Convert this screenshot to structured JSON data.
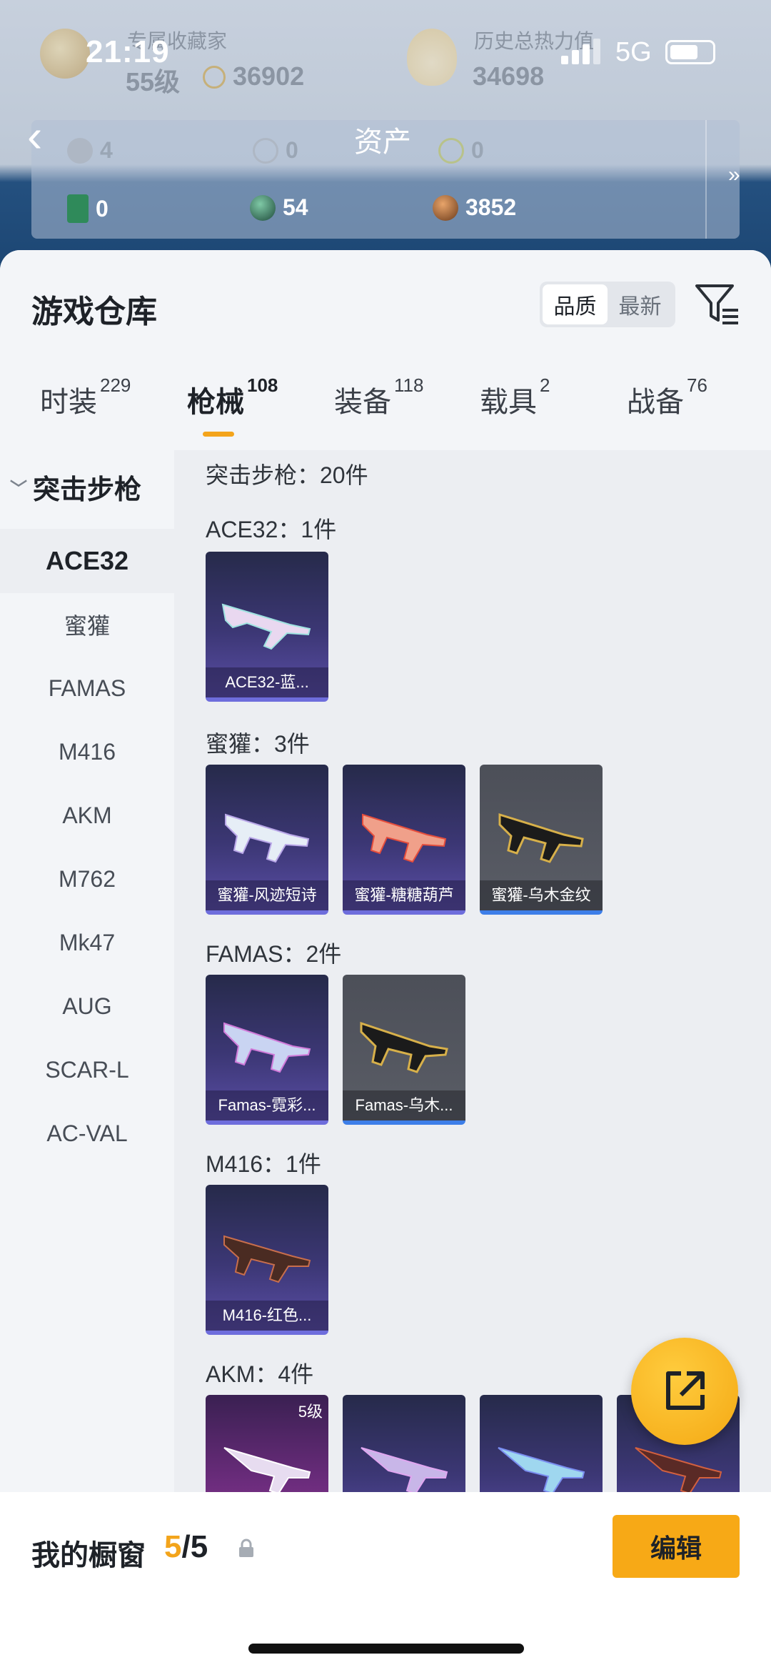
{
  "status": {
    "time": "21:19",
    "network": "5G"
  },
  "header": {
    "collector_label": "专属收藏家",
    "level": "55级",
    "coins": "36902",
    "heat_label": "历史总热力值",
    "heat_value": "34698",
    "title": "资产",
    "assets_row1": [
      "4",
      "0",
      "0"
    ],
    "assets_row2": [
      "0",
      "54",
      "3852"
    ]
  },
  "warehouse": {
    "title": "游戏仓库",
    "sort_options": [
      "品质",
      "最新"
    ],
    "sort_active": "品质"
  },
  "tabs": [
    {
      "label": "时装",
      "count": "229"
    },
    {
      "label": "枪械",
      "count": "108"
    },
    {
      "label": "装备",
      "count": "118"
    },
    {
      "label": "载具",
      "count": "2"
    },
    {
      "label": "战备",
      "count": "76"
    }
  ],
  "category_head": "突击步枪",
  "categories": [
    "ACE32",
    "蜜獾",
    "FAMAS",
    "M416",
    "AKM",
    "M762",
    "Mk47",
    "AUG",
    "SCAR-L",
    "AC-VAL"
  ],
  "content": {
    "summary": "突击步枪：20件",
    "groups": [
      {
        "label": "ACE32：1件",
        "items": [
          "ACE32-蓝..."
        ]
      },
      {
        "label": "蜜獾：3件",
        "items": [
          "蜜獾-风迹短诗",
          "蜜獾-糖糖葫芦",
          "蜜獾-乌木金纹"
        ]
      },
      {
        "label": "FAMAS：2件",
        "items": [
          "Famas-霓彩...",
          "Famas-乌木..."
        ]
      },
      {
        "label": "M416：1件",
        "items": [
          "M416-红色..."
        ]
      },
      {
        "label": "AKM：4件",
        "level_badge": "5级"
      }
    ]
  },
  "bottom": {
    "window_label": "我的橱窗",
    "window_current": "5",
    "window_sep": "/",
    "window_total": "5",
    "edit_label": "编辑"
  }
}
